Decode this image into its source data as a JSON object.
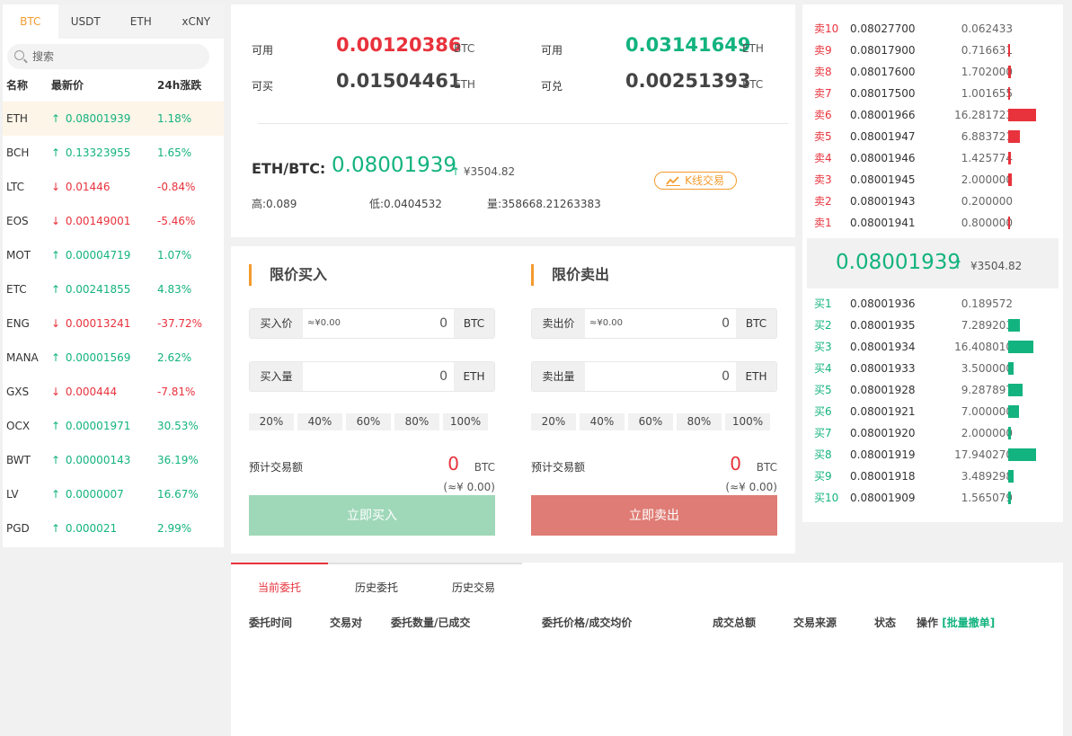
{
  "market": {
    "tabs": [
      "BTC",
      "USDT",
      "ETH",
      "xCNY"
    ],
    "search_placeholder": "搜索",
    "headers": {
      "name": "名称",
      "price": "最新价",
      "change": "24h涨跌"
    },
    "rows": [
      {
        "name": "ETH",
        "price": "0.08001939",
        "change": "1.18%",
        "dir": "up"
      },
      {
        "name": "BCH",
        "price": "0.13323955",
        "change": "1.65%",
        "dir": "up"
      },
      {
        "name": "LTC",
        "price": "0.01446",
        "change": "-0.84%",
        "dir": "down"
      },
      {
        "name": "EOS",
        "price": "0.00149001",
        "change": "-5.46%",
        "dir": "down"
      },
      {
        "name": "MOT",
        "price": "0.00004719",
        "change": "1.07%",
        "dir": "up"
      },
      {
        "name": "ETC",
        "price": "0.00241855",
        "change": "4.83%",
        "dir": "up"
      },
      {
        "name": "ENG",
        "price": "0.00013241",
        "change": "-37.72%",
        "dir": "down"
      },
      {
        "name": "MANA",
        "price": "0.00001569",
        "change": "2.62%",
        "dir": "up"
      },
      {
        "name": "GXS",
        "price": "0.000444",
        "change": "-7.81%",
        "dir": "down"
      },
      {
        "name": "OCX",
        "price": "0.00001971",
        "change": "30.53%",
        "dir": "up"
      },
      {
        "name": "BWT",
        "price": "0.00000143",
        "change": "36.19%",
        "dir": "up"
      },
      {
        "name": "LV",
        "price": "0.0000007",
        "change": "16.67%",
        "dir": "up"
      },
      {
        "name": "PGD",
        "price": "0.000021",
        "change": "2.99%",
        "dir": "up"
      }
    ]
  },
  "balances": {
    "available_label": "可用",
    "can_buy_label": "可买",
    "can_exchange_label": "可兑",
    "available_btc": "0.00120386",
    "available_eth": "0.03141649",
    "can_buy_eth": "0.01504461",
    "can_exchange_btc": "0.00251393",
    "btc": "BTC",
    "eth": "ETH"
  },
  "ticker": {
    "pair": "ETH/BTC:",
    "price": "0.08001939",
    "arrow": "↑",
    "cny": "¥3504.82",
    "kline_label": "K线交易",
    "high": "高:0.089",
    "low": "低:0.0404532",
    "volume": "量:358668.21263383"
  },
  "buy": {
    "title": "限价买入",
    "price_label": "买入价",
    "approx": "≈¥0.00",
    "price_value": "0",
    "price_unit": "BTC",
    "amount_label": "买入量",
    "amount_value": "0",
    "amount_unit": "ETH",
    "percents": [
      "20%",
      "40%",
      "60%",
      "80%",
      "100%"
    ],
    "est_label": "预计交易额",
    "est_value": "0",
    "est_unit": "BTC",
    "est_cny": "(≈¥ 0.00)",
    "button": "立即买入"
  },
  "sell": {
    "title": "限价卖出",
    "price_label": "卖出价",
    "approx": "≈¥0.00",
    "price_value": "0",
    "price_unit": "BTC",
    "amount_label": "卖出量",
    "amount_value": "0",
    "amount_unit": "ETH",
    "percents": [
      "20%",
      "40%",
      "60%",
      "80%",
      "100%"
    ],
    "est_label": "预计交易额",
    "est_value": "0",
    "est_unit": "BTC",
    "est_cny": "(≈¥ 0.00)",
    "button": "立即卖出"
  },
  "orderbook": {
    "asks": [
      {
        "tag": "卖10",
        "price": "0.08027700",
        "amount": "0.062433",
        "depth": 0.0
      },
      {
        "tag": "卖9",
        "price": "0.08017900",
        "amount": "0.716631",
        "depth": 0.04
      },
      {
        "tag": "卖8",
        "price": "0.08017600",
        "amount": "1.702000",
        "depth": 0.1
      },
      {
        "tag": "卖7",
        "price": "0.08017500",
        "amount": "1.001655",
        "depth": 0.06
      },
      {
        "tag": "卖6",
        "price": "0.08001966",
        "amount": "16.281723",
        "depth": 1.0
      },
      {
        "tag": "卖5",
        "price": "0.08001947",
        "amount": "6.883721",
        "depth": 0.42
      },
      {
        "tag": "卖4",
        "price": "0.08001946",
        "amount": "1.425774",
        "depth": 0.09
      },
      {
        "tag": "卖3",
        "price": "0.08001945",
        "amount": "2.000000",
        "depth": 0.12
      },
      {
        "tag": "卖2",
        "price": "0.08001943",
        "amount": "0.200000",
        "depth": 0.0
      },
      {
        "tag": "卖1",
        "price": "0.08001941",
        "amount": "0.800000",
        "depth": 0.05
      }
    ],
    "mid_price": "0.08001939",
    "mid_arrow": "↑",
    "mid_cny": "¥3504.82",
    "bids": [
      {
        "tag": "买1",
        "price": "0.08001936",
        "amount": "0.189572",
        "depth": 0.0
      },
      {
        "tag": "买2",
        "price": "0.08001935",
        "amount": "7.289203",
        "depth": 0.41
      },
      {
        "tag": "买3",
        "price": "0.08001934",
        "amount": "16.408010",
        "depth": 0.91
      },
      {
        "tag": "买4",
        "price": "0.08001933",
        "amount": "3.500000",
        "depth": 0.2
      },
      {
        "tag": "买5",
        "price": "0.08001928",
        "amount": "9.287897",
        "depth": 0.52
      },
      {
        "tag": "买6",
        "price": "0.08001921",
        "amount": "7.000000",
        "depth": 0.39
      },
      {
        "tag": "买7",
        "price": "0.08001920",
        "amount": "2.000000",
        "depth": 0.11
      },
      {
        "tag": "买8",
        "price": "0.08001919",
        "amount": "17.940270",
        "depth": 1.0
      },
      {
        "tag": "买9",
        "price": "0.08001918",
        "amount": "3.489298",
        "depth": 0.19
      },
      {
        "tag": "买10",
        "price": "0.08001909",
        "amount": "1.565079",
        "depth": 0.09
      }
    ]
  },
  "orders": {
    "tabs": [
      "当前委托",
      "历史委托",
      "历史交易"
    ],
    "headers": [
      "委托时间",
      "交易对",
      "委托数量/已成交",
      "委托价格/成交均价",
      "成交总额",
      "交易来源",
      "状态",
      "操作"
    ],
    "batch_cancel": "[批量撤单]"
  },
  "colors": {
    "up": "#13b37f",
    "down": "#e8323c",
    "accent": "#f39b2e"
  }
}
